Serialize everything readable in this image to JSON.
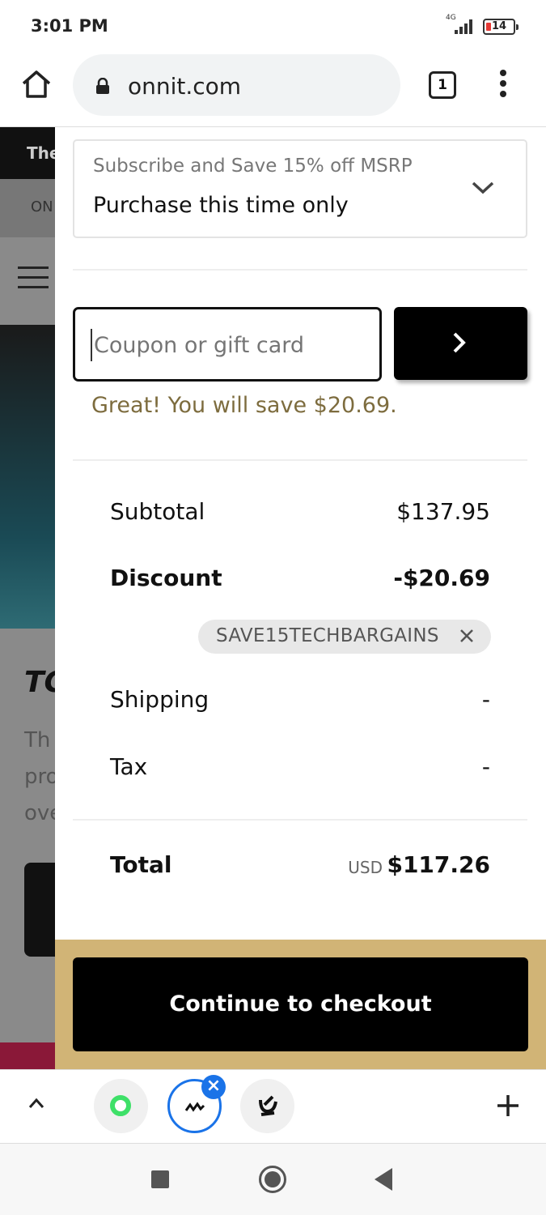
{
  "status_bar": {
    "time": "3:01 PM",
    "network": "4G",
    "battery": "14"
  },
  "browser": {
    "url": "onnit.com",
    "tab_count": "1"
  },
  "background_page": {
    "header_text": "The",
    "nav_text": "ON",
    "heading": "TC",
    "body_lines": [
      "Th",
      "pro",
      "ove"
    ]
  },
  "cart": {
    "subscribe_label": "Subscribe and Save 15% off MSRP",
    "purchase_option": "Purchase this time only",
    "coupon_placeholder": "Coupon or gift card",
    "savings_message": "Great! You will save $20.69.",
    "subtotal_label": "Subtotal",
    "subtotal_value": "$137.95",
    "discount_label": "Discount",
    "discount_value": "-$20.69",
    "coupon_code": "SAVE15TECHBARGAINS",
    "shipping_label": "Shipping",
    "shipping_value": "-",
    "tax_label": "Tax",
    "tax_value": "-",
    "total_label": "Total",
    "currency": "USD",
    "total_value": "$117.26",
    "checkout_label": "Continue to checkout"
  },
  "colors": {
    "accent_gold": "#d1b476",
    "savings_text": "#7d6c3e",
    "button_black": "#000000"
  }
}
